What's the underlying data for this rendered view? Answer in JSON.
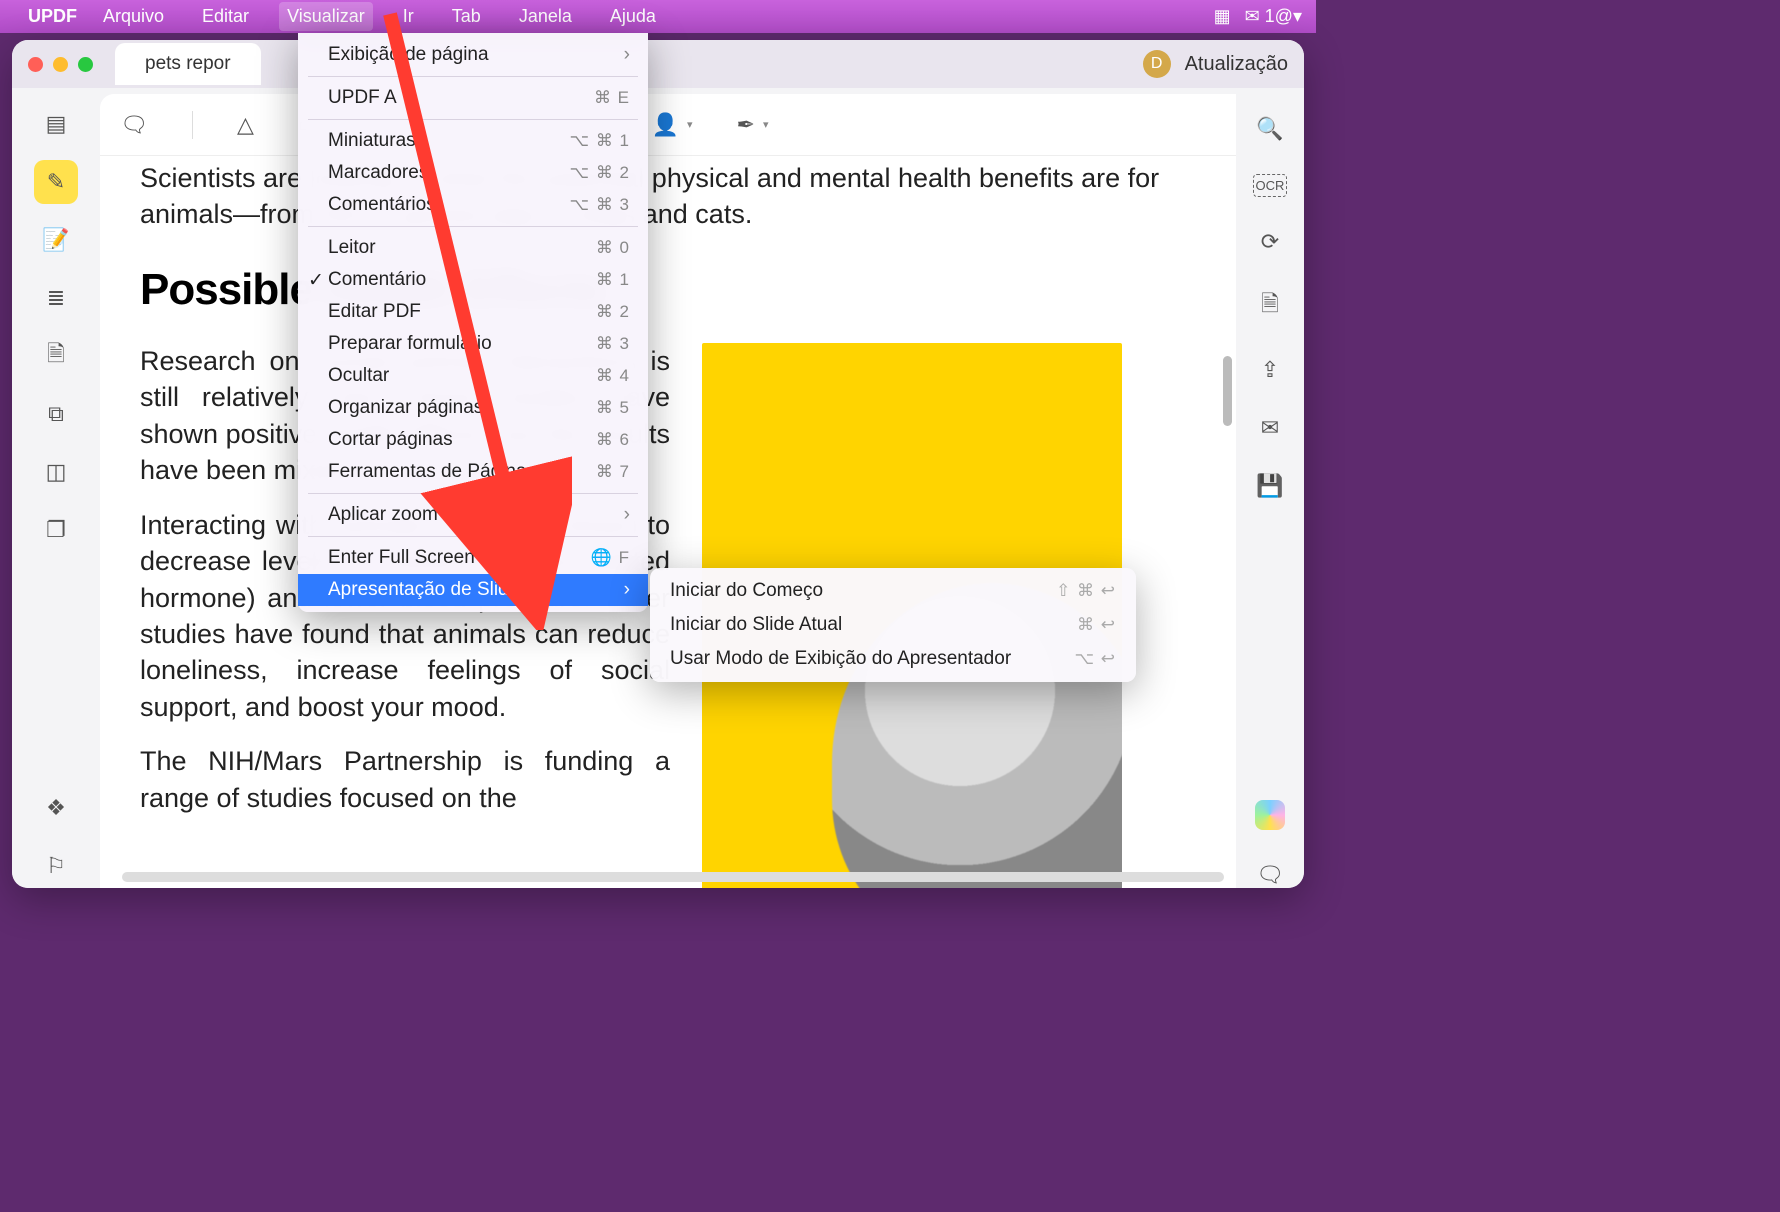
{
  "menubar": {
    "app": "UPDF",
    "items": [
      "Arquivo",
      "Editar",
      "Visualizar",
      "Ir",
      "Tab",
      "Janela",
      "Ajuda"
    ],
    "activeIndex": 2,
    "rightBadge": "1@▾"
  },
  "window": {
    "tab": "pets repor",
    "avatarLetter": "D",
    "update": "Atualização"
  },
  "dropdown": {
    "groups": [
      [
        {
          "label": "Exibição de página",
          "sc": "",
          "arrow": true
        }
      ],
      [
        {
          "label": "UPDF A",
          "sc": "⌘ E"
        }
      ],
      [
        {
          "label": "Miniaturas",
          "sc": "⌥ ⌘ 1"
        },
        {
          "label": "Marcadores",
          "sc": "⌥ ⌘ 2"
        },
        {
          "label": "Comentários",
          "sc": "⌥ ⌘ 3"
        }
      ],
      [
        {
          "label": "Leitor",
          "sc": "⌘ 0"
        },
        {
          "label": "Comentário",
          "sc": "⌘ 1",
          "checked": true
        },
        {
          "label": "Editar PDF",
          "sc": "⌘ 2"
        },
        {
          "label": "Preparar formulário",
          "sc": "⌘ 3"
        },
        {
          "label": "Ocultar",
          "sc": "⌘ 4"
        },
        {
          "label": "Organizar páginas",
          "sc": "⌘ 5"
        },
        {
          "label": "Cortar páginas",
          "sc": "⌘ 6"
        },
        {
          "label": "Ferramentas de Página",
          "sc": "⌘ 7"
        }
      ],
      [
        {
          "label": "Aplicar zoom",
          "sc": "",
          "arrow": true
        }
      ],
      [
        {
          "label": "Enter Full Screen",
          "sc": "🌐 F"
        },
        {
          "label": "Apresentação de Slides",
          "sc": "",
          "arrow": true,
          "selected": true
        }
      ]
    ]
  },
  "submenu": [
    {
      "label": "Iniciar do Começo",
      "sc": "⇧ ⌘ ↩"
    },
    {
      "label": "Iniciar do Slide Atual",
      "sc": "⌘ ↩"
    },
    {
      "label": "Usar Modo de Exibição do Apresentador",
      "sc": "⌥ ↩"
    }
  ],
  "document": {
    "line1": "Scientists are looking at what the potential physical and mental health benefits are for",
    "line2": "animals—from fish to guinea pigs to dogs and cats.",
    "heading": "Possible Health Effects",
    "p1": "Research on human-animal interactions is still relatively new. Some studies have shown positive health effects, but the results have been mixed.",
    "p2": "Interacting with animals has been shown to decrease levels of cortisol (a stress-related hormone) and lower blood pressure. Other studies have found that animals can reduce loneliness, increase feelings of social support, and boost your mood.",
    "p3": "The NIH/Mars Partnership is funding a range of studies focused on the"
  },
  "leftIcons": [
    "book-open-icon",
    "highlighter-icon",
    "note-pen-icon",
    "list-icon",
    "form-icon",
    "copy-icon",
    "crop-icon",
    "pages-icon",
    "layers-icon",
    "bookmark-icon"
  ],
  "toolbarIcons": [
    "comment-icon",
    "pen-icon",
    "text-box-icon",
    "marker-icon",
    "stamp-icon",
    "line-icon",
    "shape-icon",
    "person-icon",
    "signature-icon"
  ],
  "rightIcons": [
    "search-icon",
    "ocr-icon",
    "rotate-icon",
    "lock-page-icon",
    "share-icon",
    "mail-icon",
    "save-icon",
    "ai-flower-icon",
    "annotate-list-icon"
  ]
}
